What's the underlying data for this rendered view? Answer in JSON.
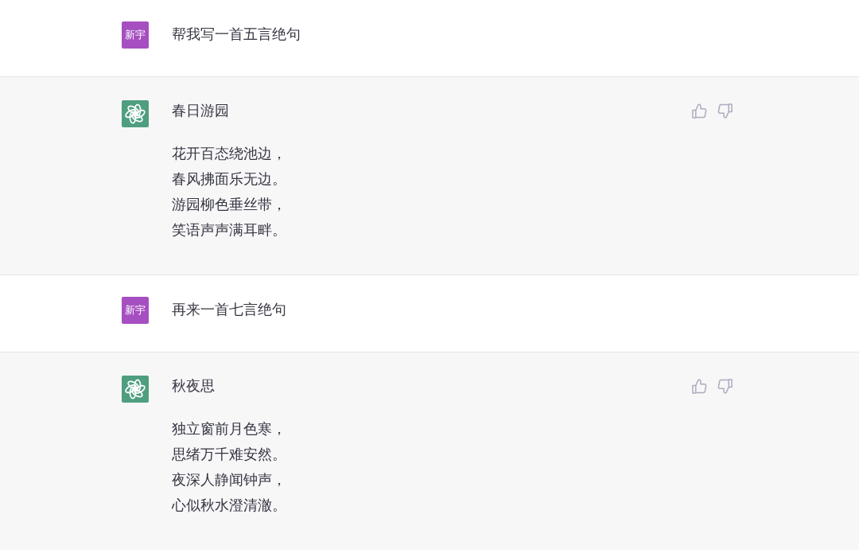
{
  "messages": [
    {
      "kind": "user",
      "avatar_text": "新宇",
      "paragraphs": [
        [
          "帮我写一首五言绝句"
        ]
      ]
    },
    {
      "kind": "assistant",
      "paragraphs": [
        [
          "春日游园"
        ],
        [
          "花开百态绕池边，",
          "春风拂面乐无边。",
          "游园柳色垂丝带，",
          "笑语声声满耳畔。"
        ]
      ]
    },
    {
      "kind": "user",
      "avatar_text": "新宇",
      "paragraphs": [
        [
          "再来一首七言绝句"
        ]
      ]
    },
    {
      "kind": "assistant",
      "paragraphs": [
        [
          "秋夜思"
        ],
        [
          "独立窗前月色寒，",
          "思绪万千难安然。",
          "夜深人静闻钟声，",
          "心似秋水澄清澈。"
        ]
      ]
    }
  ]
}
